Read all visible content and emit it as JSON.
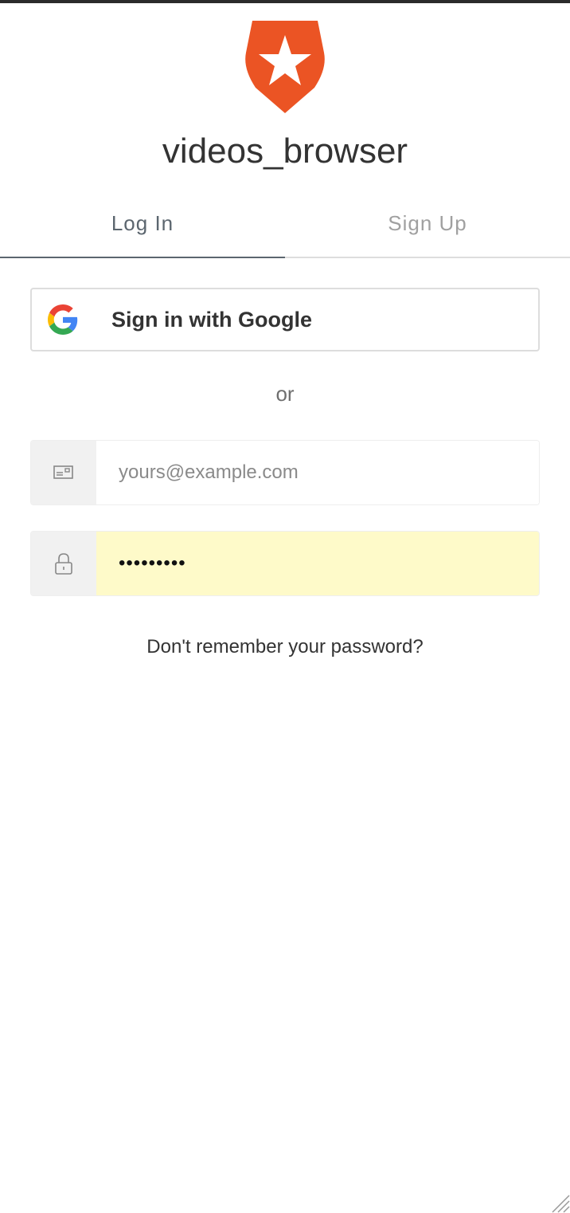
{
  "app": {
    "title": "videos_browser"
  },
  "tabs": [
    {
      "label": "Log In",
      "active": true
    },
    {
      "label": "Sign Up",
      "active": false
    }
  ],
  "social": {
    "google_label": "Sign in with Google",
    "icon": "google-g-icon"
  },
  "separator": {
    "text": "or"
  },
  "email": {
    "placeholder": "yours@example.com",
    "value": "",
    "icon": "envelope-icon"
  },
  "password": {
    "value": "•••••••••",
    "icon": "lock-icon"
  },
  "forgot": {
    "label": "Don't remember your password?"
  },
  "colors": {
    "brand": "#eb5424",
    "autofill_bg": "#fefac9",
    "active_tab": "#5c666f",
    "inactive_tab": "#a0a0a0"
  }
}
